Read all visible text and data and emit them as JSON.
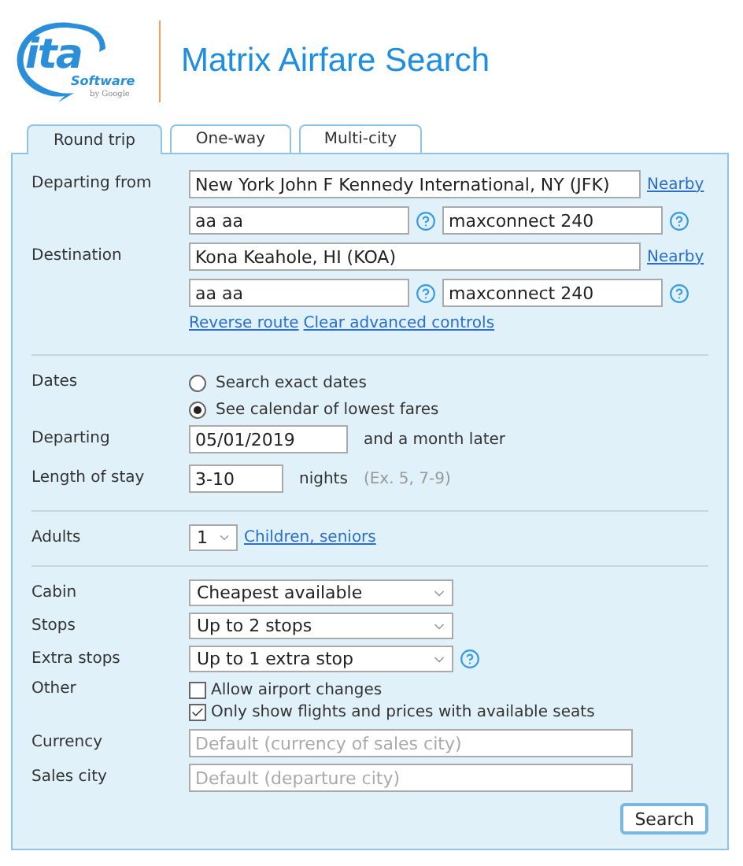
{
  "logo": {
    "mark": "ita",
    "sub": "Software",
    "by": "by Google"
  },
  "title": "Matrix Airfare Search",
  "tabs": [
    {
      "label": "Round trip",
      "selected": true
    },
    {
      "label": "One-way",
      "selected": false
    },
    {
      "label": "Multi-city",
      "selected": false
    }
  ],
  "places": [
    {
      "label": "Departing from",
      "value": "New York John F Kennedy International, NY (JFK)",
      "nearby": "Nearby",
      "routing": "aa aa",
      "extension": "maxconnect 240"
    },
    {
      "label": "Destination",
      "value": "Kona Keahole, HI (KOA)",
      "nearby": "Nearby",
      "routing": "aa aa",
      "extension": "maxconnect 240"
    }
  ],
  "route_links": [
    "Reverse route",
    "Clear advanced controls"
  ],
  "dates": {
    "label": "Dates",
    "options": [
      {
        "label": "Search exact dates",
        "selected": false
      },
      {
        "label": "See calendar of lowest fares",
        "selected": true
      }
    ]
  },
  "departing": {
    "label": "Departing",
    "value": "05/01/2019",
    "note": "and a month later"
  },
  "stay": {
    "label": "Length of stay",
    "value": "3-10",
    "unit": "nights",
    "example": "(Ex. 5, 7-9)"
  },
  "adults": {
    "label": "Adults",
    "value": "1",
    "link": "Children, seniors"
  },
  "selects": [
    {
      "label": "Cabin",
      "value": "Cheapest available",
      "help": false
    },
    {
      "label": "Stops",
      "value": "Up to 2 stops",
      "help": false
    },
    {
      "label": "Extra stops",
      "value": "Up to 1 extra stop",
      "help": true
    }
  ],
  "other": {
    "label": "Other",
    "options": [
      {
        "label": "Allow airport changes",
        "checked": false
      },
      {
        "label": "Only show flights and prices with available seats",
        "checked": true
      }
    ]
  },
  "text_fields": [
    {
      "label": "Currency",
      "placeholder": "Default (currency of sales city)"
    },
    {
      "label": "Sales city",
      "placeholder": "Default (departure city)"
    }
  ],
  "search_button": "Search"
}
